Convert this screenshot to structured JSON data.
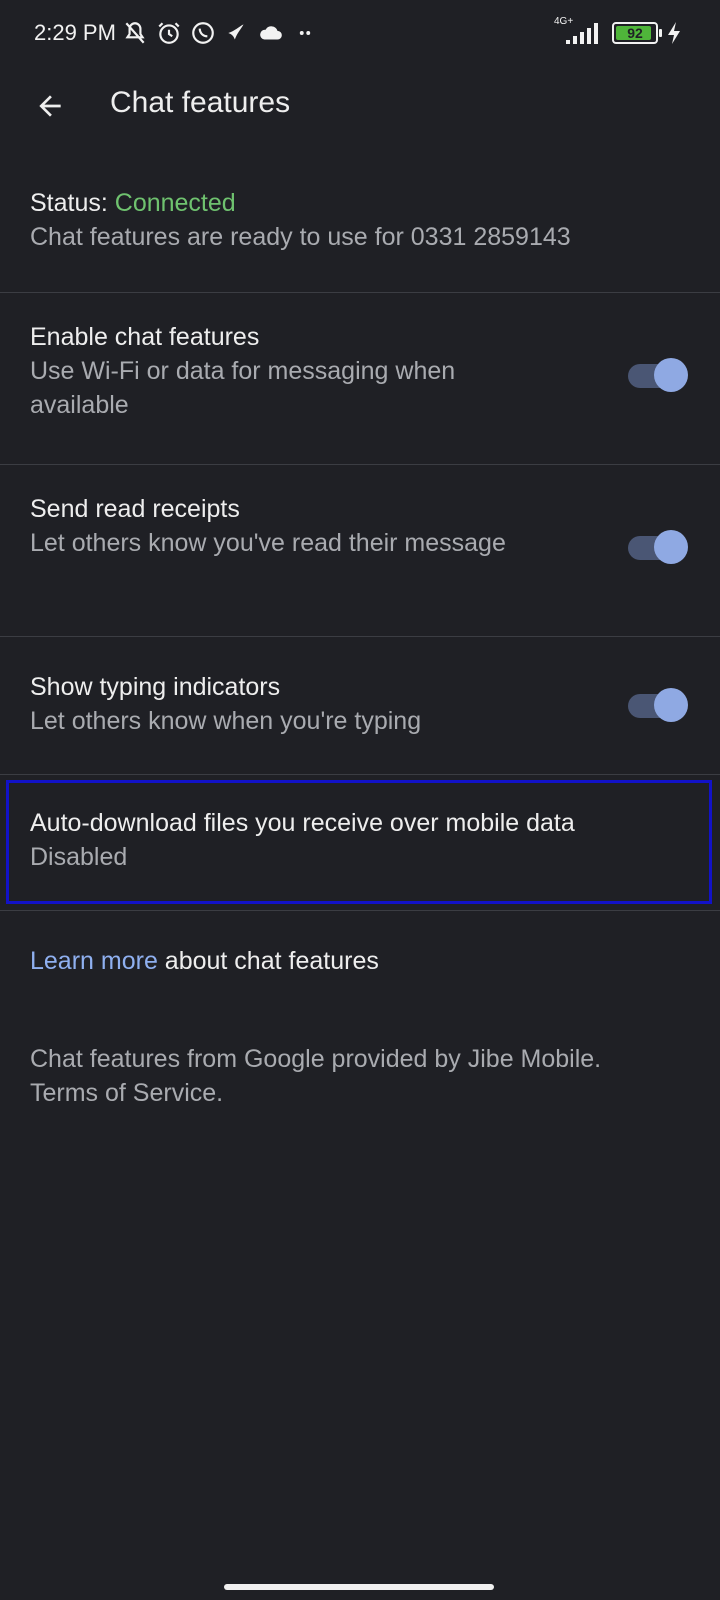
{
  "status_bar": {
    "time": "2:29 PM",
    "network": "4G+",
    "battery_level": 92,
    "battery_text": "92",
    "icons": [
      "muted-bell-icon",
      "alarm-icon",
      "whatsapp-icon",
      "telenor-icon",
      "cloud-icon",
      "more-dots-icon",
      "signal-icon",
      "battery-icon",
      "charging-icon"
    ]
  },
  "app_bar": {
    "title": "Chat features"
  },
  "status_section": {
    "label": "Status: ",
    "value": "Connected",
    "description": "Chat features are ready to use for 0331 2859143"
  },
  "settings": [
    {
      "title": "Enable chat features",
      "subtitle": "Use Wi-Fi or data for messaging when available",
      "enabled": true
    },
    {
      "title": "Send read receipts",
      "subtitle": "Let others know you've read their message",
      "enabled": true
    },
    {
      "title": "Show typing indicators",
      "subtitle": "Let others know when you're typing",
      "enabled": true
    }
  ],
  "auto_download": {
    "title": "Auto-download files you receive over mobile data",
    "value": "Disabled"
  },
  "learn_more": {
    "link_text": "Learn more",
    "rest_text": " about chat features"
  },
  "footer": {
    "text": "Chat features from Google provided by Jibe Mobile. Terms of Service."
  },
  "colors": {
    "background": "#1f2025",
    "connected": "#6fc26f",
    "link": "#8fb0f0",
    "toggle_thumb": "#8fa9e3",
    "highlight_border": "#1212c8"
  }
}
